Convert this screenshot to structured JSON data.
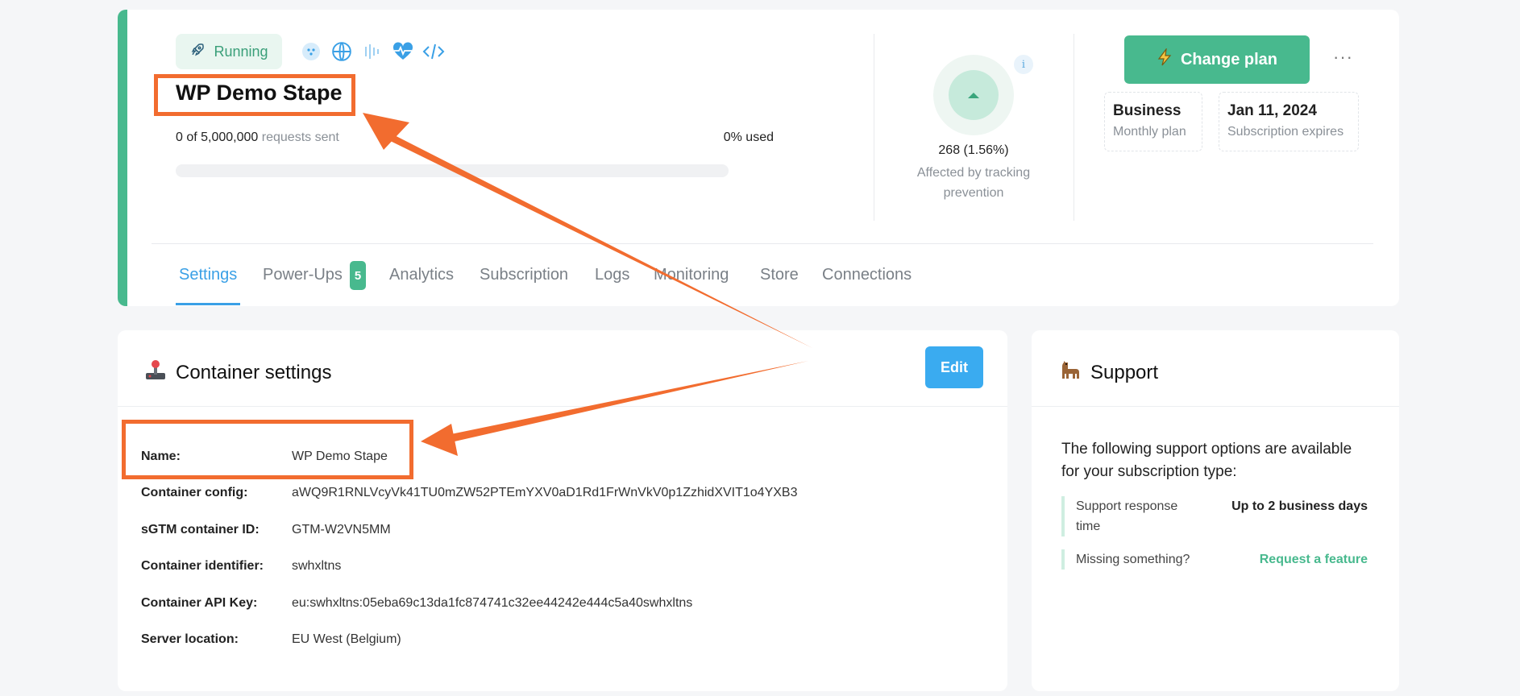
{
  "header": {
    "status": {
      "label": "Running",
      "icon": "rocket-icon"
    },
    "status_icons": [
      "dots-icon",
      "globe-icon",
      "bars-icon",
      "heartbeat-icon",
      "code-icon"
    ],
    "container_name": "WP Demo Stape",
    "requests": {
      "count": "0 of 5,000,000",
      "suffix": "requests sent",
      "used_label": "0% used",
      "used_fraction": 0
    },
    "tracking_prevention": {
      "value": "268 (1.56%)",
      "label": "Affected by tracking prevention",
      "info_icon": "i"
    },
    "change_plan_label": "Change plan",
    "more_label": "···",
    "plan": {
      "name": "Business",
      "type": "Monthly plan"
    },
    "expiry": {
      "date": "Jan 11, 2024",
      "label": "Subscription expires"
    },
    "tabs": [
      {
        "label": "Settings",
        "active": true
      },
      {
        "label": "Power-Ups",
        "badge": "5"
      },
      {
        "label": "Analytics"
      },
      {
        "label": "Subscription"
      },
      {
        "label": "Logs"
      },
      {
        "label": "Monitoring"
      },
      {
        "label": "Store"
      },
      {
        "label": "Connections"
      }
    ]
  },
  "settings": {
    "title": "Container settings",
    "title_icon": "joystick-icon",
    "edit_label": "Edit",
    "rows": [
      {
        "key": "Name:",
        "value": "WP Demo Stape"
      },
      {
        "key": "Container config:",
        "value": "aWQ9R1RNLVcyVk41TU0mZW52PTEmYXV0aD1Rd1FrWnVkV0p1ZzhidXVIT1o4YXB3"
      },
      {
        "key": "sGTM container ID:",
        "value": "GTM-W2VN5MM"
      },
      {
        "key": "Container identifier:",
        "value": "swhxltns"
      },
      {
        "key": "Container API Key:",
        "value": "eu:swhxltns:05eba69c13da1fc874741c32ee44242e444c5a40swhxltns"
      },
      {
        "key": "Server location:",
        "value": "EU West (Belgium)"
      }
    ]
  },
  "support": {
    "title": "Support",
    "title_icon": "llama-icon",
    "intro": "The following support options are available for your subscription type:",
    "items": [
      {
        "label": "Support response time",
        "value": "Up to 2 business days"
      },
      {
        "label": "Missing something?",
        "value": "Request a feature"
      }
    ]
  },
  "colors": {
    "accent_green": "#48b98e",
    "accent_blue": "#3aa0e6",
    "annotation_orange": "#f26c2f"
  }
}
